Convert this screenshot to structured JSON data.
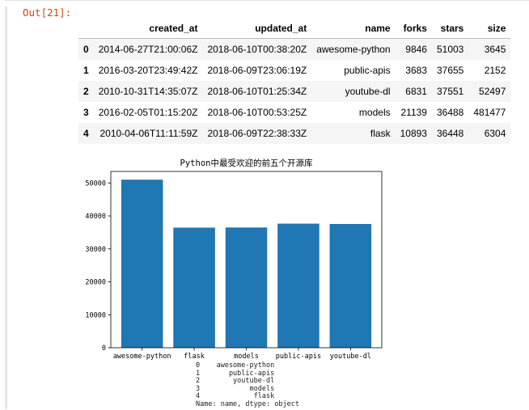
{
  "prompt": "Out[21]:",
  "table": {
    "columns": [
      "created_at",
      "updated_at",
      "name",
      "forks",
      "stars",
      "size"
    ],
    "rows": [
      {
        "index": "0",
        "cells": [
          "2014-06-27T21:00:06Z",
          "2018-06-10T00:38:20Z",
          "awesome-python",
          "9846",
          "51003",
          "3645"
        ]
      },
      {
        "index": "1",
        "cells": [
          "2016-03-20T23:49:42Z",
          "2018-06-09T23:06:19Z",
          "public-apis",
          "3683",
          "37655",
          "2152"
        ]
      },
      {
        "index": "2",
        "cells": [
          "2010-10-31T14:35:07Z",
          "2018-06-10T01:25:34Z",
          "youtube-dl",
          "6831",
          "37551",
          "52497"
        ]
      },
      {
        "index": "3",
        "cells": [
          "2016-02-05T01:15:20Z",
          "2018-06-10T00:53:25Z",
          "models",
          "21139",
          "36488",
          "481477"
        ]
      },
      {
        "index": "4",
        "cells": [
          "2010-04-06T11:11:59Z",
          "2018-06-09T22:38:33Z",
          "flask",
          "10893",
          "36448",
          "6304"
        ]
      }
    ]
  },
  "chart_data": {
    "type": "bar",
    "title": "Python中最受欢迎的前五个开源库",
    "categories": [
      "awesome-python",
      "flask",
      "models",
      "public-apis",
      "youtube-dl"
    ],
    "values": [
      51003,
      36448,
      36488,
      37655,
      37551
    ],
    "yticks": [
      0,
      10000,
      20000,
      30000,
      40000,
      50000
    ],
    "ylim": [
      0,
      53500
    ],
    "xlabel": "",
    "ylabel": "",
    "grid": false,
    "color": "#1f77b4"
  },
  "series_print": {
    "lines": [
      "0    awesome-python",
      "1       public-apis",
      "2        youtube-dl",
      "3            models",
      "4             flask",
      "Name: name, dtype: object"
    ]
  }
}
